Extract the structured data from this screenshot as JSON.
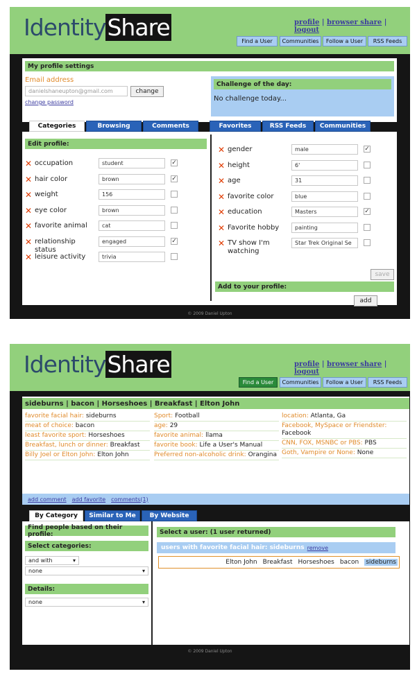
{
  "colors": {
    "green": "#92d07c",
    "blue": "#a9cdf2",
    "dark": "#151515",
    "tab_blue": "#2a63b8",
    "accent_orange": "#e08a2a",
    "remove_red": "#e03a00"
  },
  "screen1": {
    "logo": {
      "part1": "Identity",
      "part2": "Share"
    },
    "top_links": [
      "profile",
      "browser share",
      "logout"
    ],
    "nav": [
      "Find a User",
      "Communities",
      "Follow a User",
      "RSS Feeds"
    ],
    "settings": {
      "title": "My profile settings",
      "email_label": "Email address",
      "email_value": "danielshaneupton@gmail.com",
      "change_label": "change",
      "change_password": "change password",
      "challenge_title": "Challenge of the day:",
      "challenge_text": "No challenge today..."
    },
    "tabs": [
      "Categories",
      "Browsing",
      "Comments",
      "Favorites",
      "RSS Feeds",
      "Communities"
    ],
    "edit_title": "Edit profile:",
    "left_fields": [
      {
        "label": "occupation",
        "value": "student",
        "checked": true
      },
      {
        "label": "hair color",
        "value": "brown",
        "checked": true
      },
      {
        "label": "weight",
        "value": "156",
        "checked": false
      },
      {
        "label": "eye color",
        "value": "brown",
        "checked": false
      },
      {
        "label": "favorite animal",
        "value": "cat",
        "checked": false
      },
      {
        "label": "relationship status",
        "value": "engaged",
        "checked": true
      },
      {
        "label": "leisure activity",
        "value": "trivia",
        "checked": false
      }
    ],
    "right_fields": [
      {
        "label": "gender",
        "value": "male",
        "checked": true
      },
      {
        "label": "height",
        "value": "6'",
        "checked": false
      },
      {
        "label": "age",
        "value": "31",
        "checked": false
      },
      {
        "label": "favorite color",
        "value": "blue",
        "checked": false
      },
      {
        "label": "education",
        "value": "Masters",
        "checked": true
      },
      {
        "label": "Favorite hobby",
        "value": "painting",
        "checked": false
      },
      {
        "label": "TV show I'm watching",
        "value": "Star Trek Original Se",
        "checked": false
      }
    ],
    "save_label": "save",
    "add_title": "Add to your profile:",
    "add_label": "add",
    "footer": "© 2009 Daniel Upton"
  },
  "screen2": {
    "logo": {
      "part1": "Identity",
      "part2": "Share"
    },
    "top_links": [
      "profile",
      "browser share",
      "logout"
    ],
    "nav": [
      "Find a User",
      "Communities",
      "Follow a User",
      "RSS Feeds"
    ],
    "profile_header": "sideburns | bacon | Horseshoes | Breakfast | Elton John",
    "col1": [
      {
        "k": "favorite facial hair:",
        "v": "sideburns"
      },
      {
        "k": "meat of choice:",
        "v": "bacon"
      },
      {
        "k": "least favorite sport:",
        "v": "Horseshoes"
      },
      {
        "k": "Breakfast, lunch or dinner:",
        "v": "Breakfast"
      },
      {
        "k": "Billy Joel or Elton John:",
        "v": "Elton John"
      }
    ],
    "col2": [
      {
        "k": "Sport:",
        "v": "Football"
      },
      {
        "k": "age:",
        "v": "29"
      },
      {
        "k": "favorite animal:",
        "v": "llama"
      },
      {
        "k": "favorite book:",
        "v": "Life a User's Manual"
      },
      {
        "k": "Preferred non-alcoholic drink:",
        "v": "Orangina"
      }
    ],
    "col3": [
      {
        "k": "location:",
        "v": "Atlanta, Ga"
      },
      {
        "k": "Facebook, MySpace or Friendster:",
        "v": "Facebook"
      },
      {
        "k": "CNN, FOX, MSNBC or PBS:",
        "v": "PBS"
      },
      {
        "k": "Goth, Vampire or None:",
        "v": "None"
      }
    ],
    "actions": [
      "add comment",
      "add favorite",
      "comments(1)"
    ],
    "tabs": [
      "By Category",
      "Similar to Me",
      "By Website"
    ],
    "find_title": "Find people based on their profile:",
    "select_categories": "Select categories:",
    "and_with": "and with",
    "none1": "none",
    "details": "Details:",
    "none2": "none",
    "select_user": "Select a user: (1 user returned)",
    "filter_text": "users with favorite facial hair: sideburns",
    "remove": "remove",
    "result_tags": [
      "Elton John",
      "Breakfast",
      "Horseshoes",
      "bacon",
      "sideburns"
    ],
    "footer": "© 2009 Daniel Upton"
  }
}
